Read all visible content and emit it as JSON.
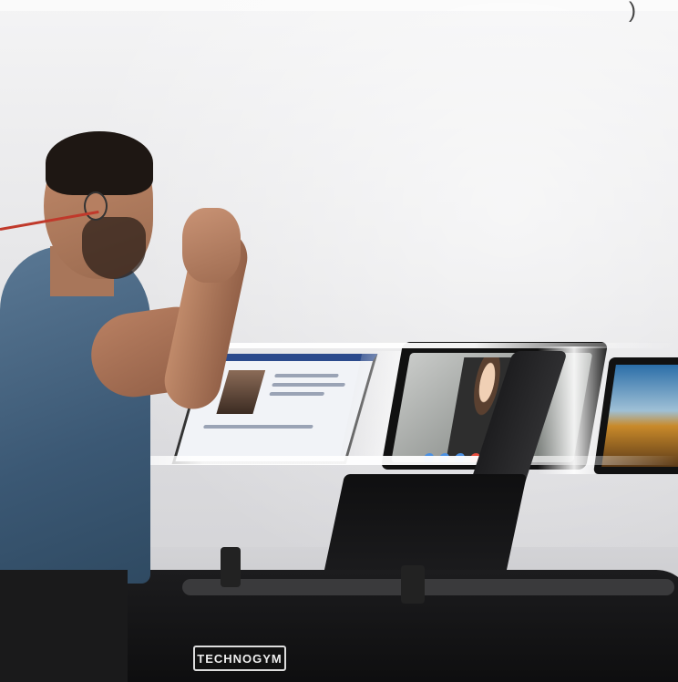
{
  "brand": {
    "logo_text": "TECHNOGYM"
  },
  "colors": {
    "shirt": "#3b5874",
    "treadmill": "#111111",
    "screen_header": "#2b4a8c",
    "call_buttons": [
      "#4a90e2",
      "#4a90e2",
      "#4a90e2",
      "#e74c3c"
    ]
  },
  "screens": [
    {
      "name": "social-feed-screen"
    },
    {
      "name": "video-call-screen"
    },
    {
      "name": "landscape-screen"
    }
  ]
}
